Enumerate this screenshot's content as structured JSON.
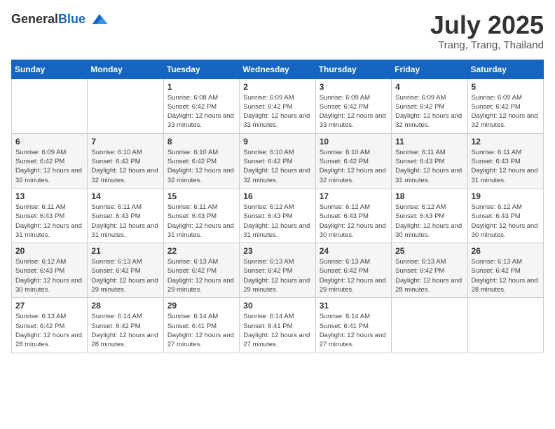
{
  "header": {
    "logo_general": "General",
    "logo_blue": "Blue",
    "month_title": "July 2025",
    "location": "Trang, Trang, Thailand"
  },
  "weekdays": [
    "Sunday",
    "Monday",
    "Tuesday",
    "Wednesday",
    "Thursday",
    "Friday",
    "Saturday"
  ],
  "weeks": [
    [
      {
        "day": "",
        "info": ""
      },
      {
        "day": "",
        "info": ""
      },
      {
        "day": "1",
        "info": "Sunrise: 6:08 AM\nSunset: 6:42 PM\nDaylight: 12 hours and 33 minutes."
      },
      {
        "day": "2",
        "info": "Sunrise: 6:09 AM\nSunset: 6:42 PM\nDaylight: 12 hours and 33 minutes."
      },
      {
        "day": "3",
        "info": "Sunrise: 6:09 AM\nSunset: 6:42 PM\nDaylight: 12 hours and 33 minutes."
      },
      {
        "day": "4",
        "info": "Sunrise: 6:09 AM\nSunset: 6:42 PM\nDaylight: 12 hours and 32 minutes."
      },
      {
        "day": "5",
        "info": "Sunrise: 6:09 AM\nSunset: 6:42 PM\nDaylight: 12 hours and 32 minutes."
      }
    ],
    [
      {
        "day": "6",
        "info": "Sunrise: 6:09 AM\nSunset: 6:42 PM\nDaylight: 12 hours and 32 minutes."
      },
      {
        "day": "7",
        "info": "Sunrise: 6:10 AM\nSunset: 6:42 PM\nDaylight: 12 hours and 32 minutes."
      },
      {
        "day": "8",
        "info": "Sunrise: 6:10 AM\nSunset: 6:42 PM\nDaylight: 12 hours and 32 minutes."
      },
      {
        "day": "9",
        "info": "Sunrise: 6:10 AM\nSunset: 6:42 PM\nDaylight: 12 hours and 32 minutes."
      },
      {
        "day": "10",
        "info": "Sunrise: 6:10 AM\nSunset: 6:42 PM\nDaylight: 12 hours and 32 minutes."
      },
      {
        "day": "11",
        "info": "Sunrise: 6:11 AM\nSunset: 6:43 PM\nDaylight: 12 hours and 31 minutes."
      },
      {
        "day": "12",
        "info": "Sunrise: 6:11 AM\nSunset: 6:43 PM\nDaylight: 12 hours and 31 minutes."
      }
    ],
    [
      {
        "day": "13",
        "info": "Sunrise: 6:11 AM\nSunset: 6:43 PM\nDaylight: 12 hours and 31 minutes."
      },
      {
        "day": "14",
        "info": "Sunrise: 6:11 AM\nSunset: 6:43 PM\nDaylight: 12 hours and 31 minutes."
      },
      {
        "day": "15",
        "info": "Sunrise: 6:11 AM\nSunset: 6:43 PM\nDaylight: 12 hours and 31 minutes."
      },
      {
        "day": "16",
        "info": "Sunrise: 6:12 AM\nSunset: 6:43 PM\nDaylight: 12 hours and 31 minutes."
      },
      {
        "day": "17",
        "info": "Sunrise: 6:12 AM\nSunset: 6:43 PM\nDaylight: 12 hours and 30 minutes."
      },
      {
        "day": "18",
        "info": "Sunrise: 6:12 AM\nSunset: 6:43 PM\nDaylight: 12 hours and 30 minutes."
      },
      {
        "day": "19",
        "info": "Sunrise: 6:12 AM\nSunset: 6:43 PM\nDaylight: 12 hours and 30 minutes."
      }
    ],
    [
      {
        "day": "20",
        "info": "Sunrise: 6:12 AM\nSunset: 6:43 PM\nDaylight: 12 hours and 30 minutes."
      },
      {
        "day": "21",
        "info": "Sunrise: 6:13 AM\nSunset: 6:42 PM\nDaylight: 12 hours and 29 minutes."
      },
      {
        "day": "22",
        "info": "Sunrise: 6:13 AM\nSunset: 6:42 PM\nDaylight: 12 hours and 29 minutes."
      },
      {
        "day": "23",
        "info": "Sunrise: 6:13 AM\nSunset: 6:42 PM\nDaylight: 12 hours and 29 minutes."
      },
      {
        "day": "24",
        "info": "Sunrise: 6:13 AM\nSunset: 6:42 PM\nDaylight: 12 hours and 29 minutes."
      },
      {
        "day": "25",
        "info": "Sunrise: 6:13 AM\nSunset: 6:42 PM\nDaylight: 12 hours and 28 minutes."
      },
      {
        "day": "26",
        "info": "Sunrise: 6:13 AM\nSunset: 6:42 PM\nDaylight: 12 hours and 28 minutes."
      }
    ],
    [
      {
        "day": "27",
        "info": "Sunrise: 6:13 AM\nSunset: 6:42 PM\nDaylight: 12 hours and 28 minutes."
      },
      {
        "day": "28",
        "info": "Sunrise: 6:14 AM\nSunset: 6:42 PM\nDaylight: 12 hours and 28 minutes."
      },
      {
        "day": "29",
        "info": "Sunrise: 6:14 AM\nSunset: 6:41 PM\nDaylight: 12 hours and 27 minutes."
      },
      {
        "day": "30",
        "info": "Sunrise: 6:14 AM\nSunset: 6:41 PM\nDaylight: 12 hours and 27 minutes."
      },
      {
        "day": "31",
        "info": "Sunrise: 6:14 AM\nSunset: 6:41 PM\nDaylight: 12 hours and 27 minutes."
      },
      {
        "day": "",
        "info": ""
      },
      {
        "day": "",
        "info": ""
      }
    ]
  ]
}
